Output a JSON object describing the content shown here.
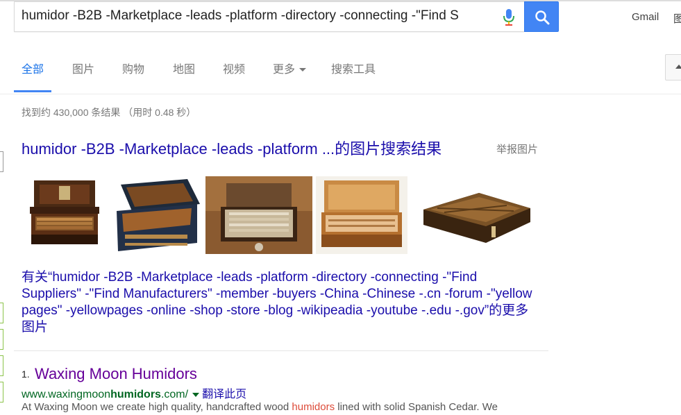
{
  "search": {
    "query": "humidor -B2B -Marketplace -leads -platform -directory -connecting -\"Find S",
    "icons": {
      "mic": "microphone-icon",
      "search": "search-icon"
    }
  },
  "header": {
    "gmail": "Gmail",
    "images_link": "图"
  },
  "tabs": [
    {
      "label": "全部",
      "active": true
    },
    {
      "label": "图片"
    },
    {
      "label": "购物"
    },
    {
      "label": "地图"
    },
    {
      "label": "视频"
    },
    {
      "label": "更多"
    },
    {
      "label": "搜索工具"
    }
  ],
  "stats": "找到约 430,000 条结果 （用时 0.48 秒）",
  "image_block": {
    "heading": "humidor -B2B -Marketplace -leads -platform ...的图片搜索结果",
    "report": "举报图片",
    "more_link": "有关“humidor -B2B -Marketplace -leads -platform -directory -connecting -\"Find Suppliers\" -\"Find Manufacturers\" -member -buyers -China -Chinese -.cn -forum -\"yellow pages\" -yellowpages -online -shop -store -blog -wikipeadia -youtube -.edu -.gov”的更多图片"
  },
  "results": [
    {
      "num": "1.",
      "title": "Waxing Moon Humidors",
      "url_prefix": "www.waxingmoon",
      "url_bold": "humidors",
      "url_suffix": ".com/",
      "translate": "翻译此页",
      "snippet_before": "At Waxing Moon we create high quality, handcrafted wood ",
      "snippet_highlight": "humidors",
      "snippet_after": " lined with solid Spanish Cedar. We"
    }
  ],
  "colors": {
    "link": "#1a0dab",
    "visited": "#660099",
    "url": "#006621",
    "accent": "#4285f4",
    "highlight": "#dd4b39"
  }
}
